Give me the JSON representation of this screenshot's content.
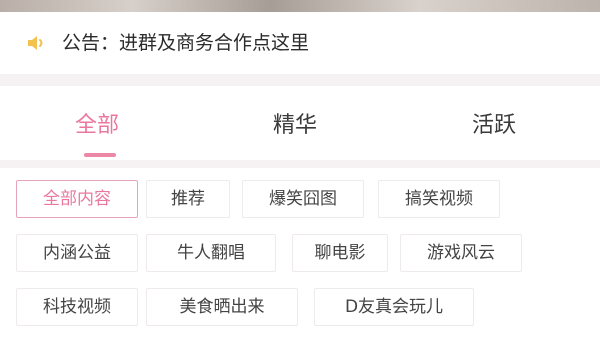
{
  "notice": {
    "icon": "speaker-icon",
    "text": "公告：进群及商务合作点这里"
  },
  "tabs": [
    {
      "label": "全部",
      "active": true
    },
    {
      "label": "精华",
      "active": false
    },
    {
      "label": "活跃",
      "active": false
    }
  ],
  "chips": [
    {
      "label": "全部内容",
      "selected": true
    },
    {
      "label": "推荐",
      "selected": false
    },
    {
      "label": "爆笑囧图",
      "selected": false
    },
    {
      "label": "搞笑视频",
      "selected": false
    },
    {
      "label": "内涵公益",
      "selected": false
    },
    {
      "label": "牛人翻唱",
      "selected": false
    },
    {
      "label": "聊电影",
      "selected": false
    },
    {
      "label": "游戏风云",
      "selected": false
    },
    {
      "label": "科技视频",
      "selected": false
    },
    {
      "label": "美食晒出来",
      "selected": false
    },
    {
      "label": "D友真会玩儿",
      "selected": false
    }
  ],
  "colors": {
    "accent": "#e8799d",
    "accent_border": "#e7a4b8",
    "icon_yellow": "#f2c14e"
  }
}
